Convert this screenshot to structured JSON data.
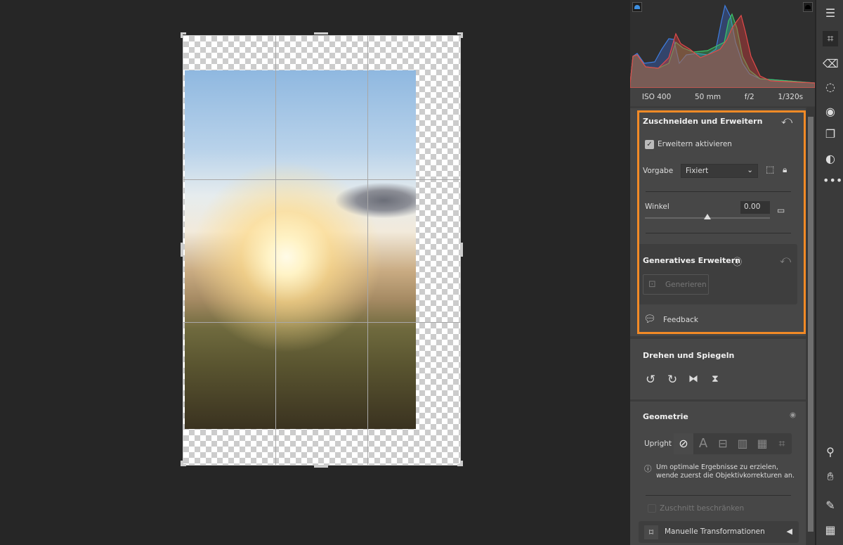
{
  "exif": {
    "iso": "ISO 400",
    "focal": "50 mm",
    "aperture": "f/2",
    "shutter": "1/320s"
  },
  "crop": {
    "title": "Zuschneiden und Erweitern",
    "enable_label": "Erweitern aktivieren",
    "enable_checked": true,
    "preset_label": "Vorgabe",
    "preset_value": "Fixiert",
    "angle_label": "Winkel",
    "angle_value": "0.00",
    "angle_slider_percent": 50
  },
  "generative": {
    "title": "Generatives Erweitern",
    "button": "Generieren"
  },
  "feedback": "Feedback",
  "rotate": {
    "title": "Drehen und Spiegeln"
  },
  "geometry": {
    "title": "Geometrie",
    "upright_label": "Upright",
    "info": "Um optimale Ergebnisse zu erzielen, wende zuerst die Objektivkorrekturen an.",
    "constrain_label": "Zuschnitt beschränken",
    "constrain_checked": false,
    "manual": "Manuelle Transformationen"
  },
  "colors": {
    "highlight": "#f28a26",
    "panel": "#3c3c3c",
    "section": "#474747"
  }
}
